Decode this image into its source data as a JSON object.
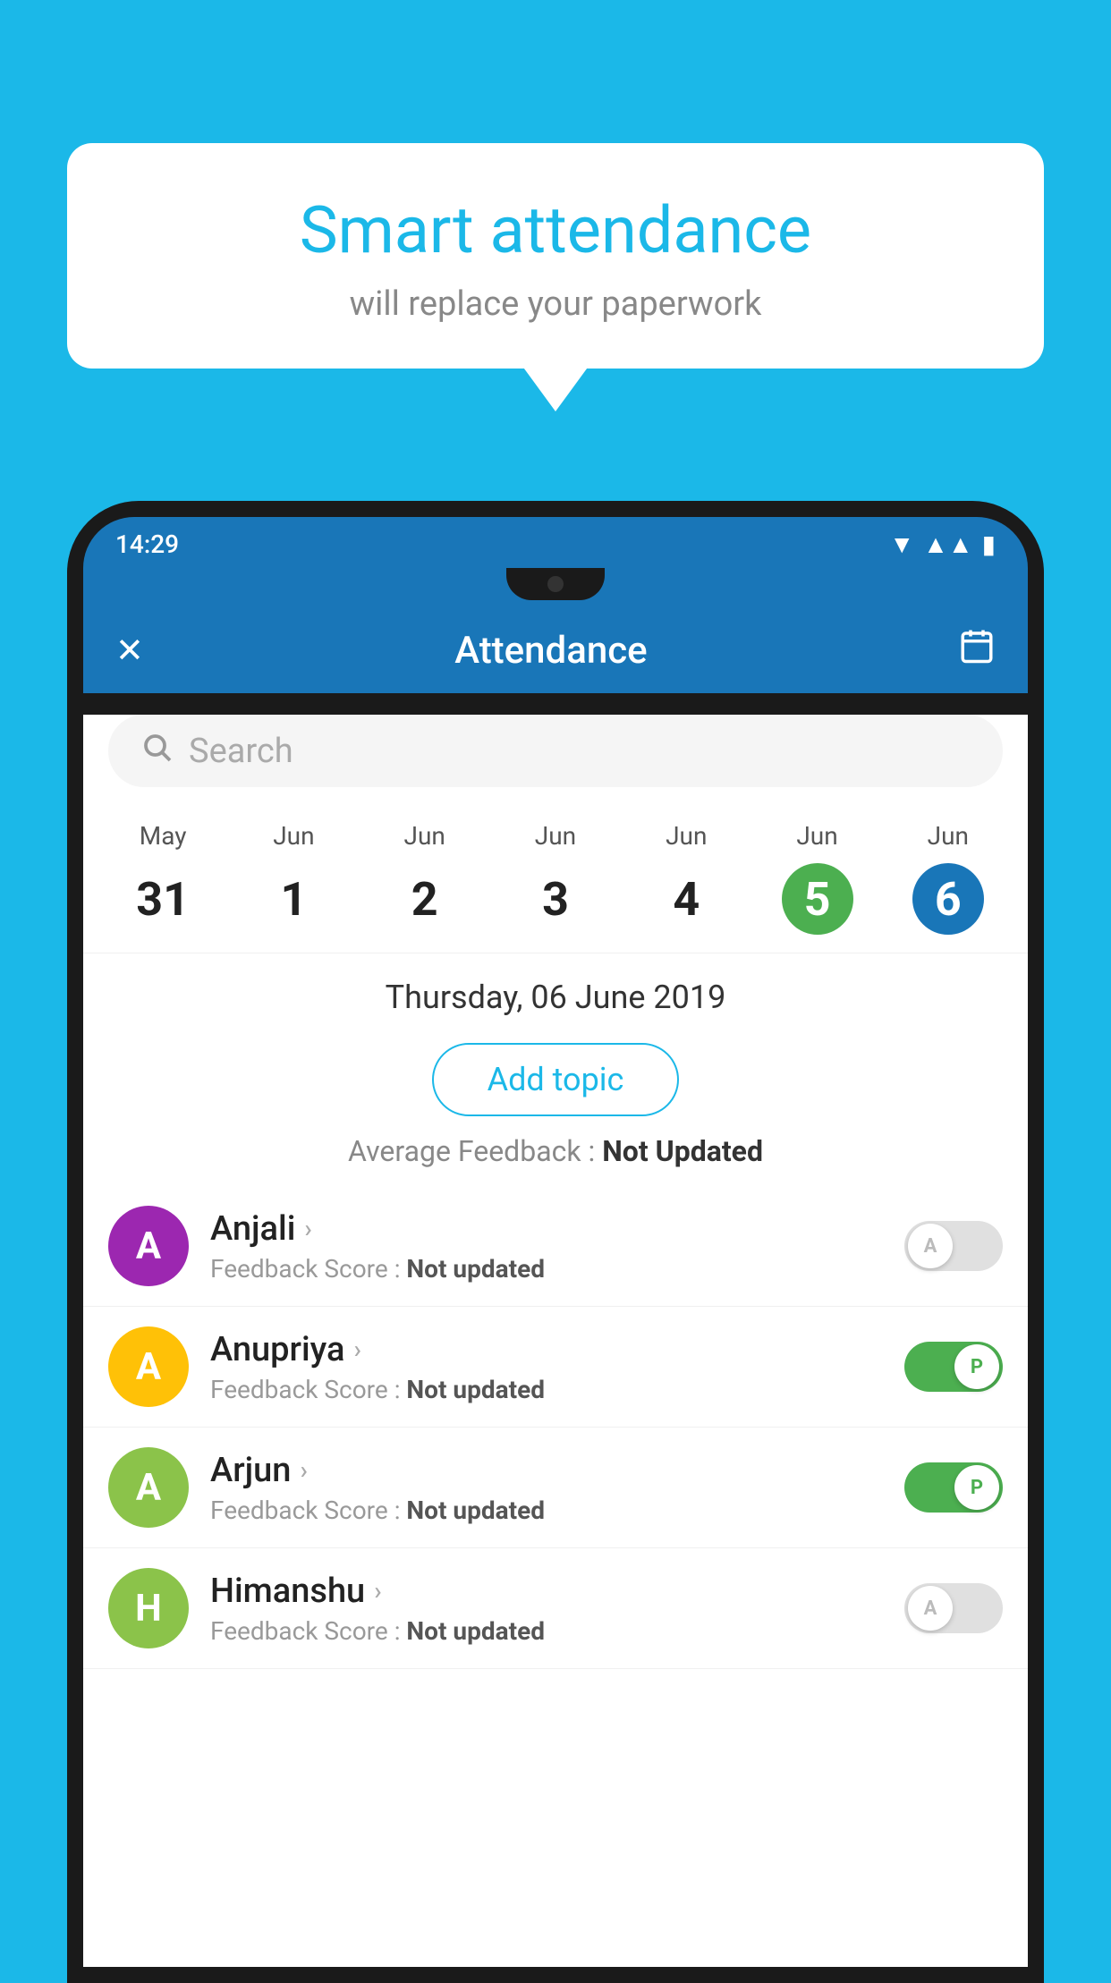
{
  "background_color": "#1BB8E8",
  "speech_bubble": {
    "title": "Smart attendance",
    "subtitle": "will replace your paperwork"
  },
  "phone": {
    "status_bar": {
      "time": "14:29",
      "icons": [
        "wifi",
        "signal",
        "battery"
      ]
    },
    "app_header": {
      "close_label": "✕",
      "title": "Attendance",
      "calendar_icon": "📅"
    },
    "search": {
      "placeholder": "Search"
    },
    "calendar": {
      "days": [
        {
          "month": "May",
          "date": "31",
          "state": "normal"
        },
        {
          "month": "Jun",
          "date": "1",
          "state": "normal"
        },
        {
          "month": "Jun",
          "date": "2",
          "state": "normal"
        },
        {
          "month": "Jun",
          "date": "3",
          "state": "normal"
        },
        {
          "month": "Jun",
          "date": "4",
          "state": "normal"
        },
        {
          "month": "Jun",
          "date": "5",
          "state": "today"
        },
        {
          "month": "Jun",
          "date": "6",
          "state": "selected"
        }
      ]
    },
    "selected_date": "Thursday, 06 June 2019",
    "add_topic_label": "Add topic",
    "avg_feedback_label": "Average Feedback :",
    "avg_feedback_value": "Not Updated",
    "students": [
      {
        "name": "Anjali",
        "avatar_letter": "A",
        "avatar_color": "#9C27B0",
        "feedback_label": "Feedback Score :",
        "feedback_value": "Not updated",
        "toggle": "off",
        "toggle_letter": "A"
      },
      {
        "name": "Anupriya",
        "avatar_letter": "A",
        "avatar_color": "#FFC107",
        "feedback_label": "Feedback Score :",
        "feedback_value": "Not updated",
        "toggle": "on",
        "toggle_letter": "P"
      },
      {
        "name": "Arjun",
        "avatar_letter": "A",
        "avatar_color": "#8BC34A",
        "feedback_label": "Feedback Score :",
        "feedback_value": "Not updated",
        "toggle": "on",
        "toggle_letter": "P"
      },
      {
        "name": "Himanshu",
        "avatar_letter": "H",
        "avatar_color": "#8BC34A",
        "feedback_label": "Feedback Score :",
        "feedback_value": "Not updated",
        "toggle": "off",
        "toggle_letter": "A"
      }
    ]
  }
}
